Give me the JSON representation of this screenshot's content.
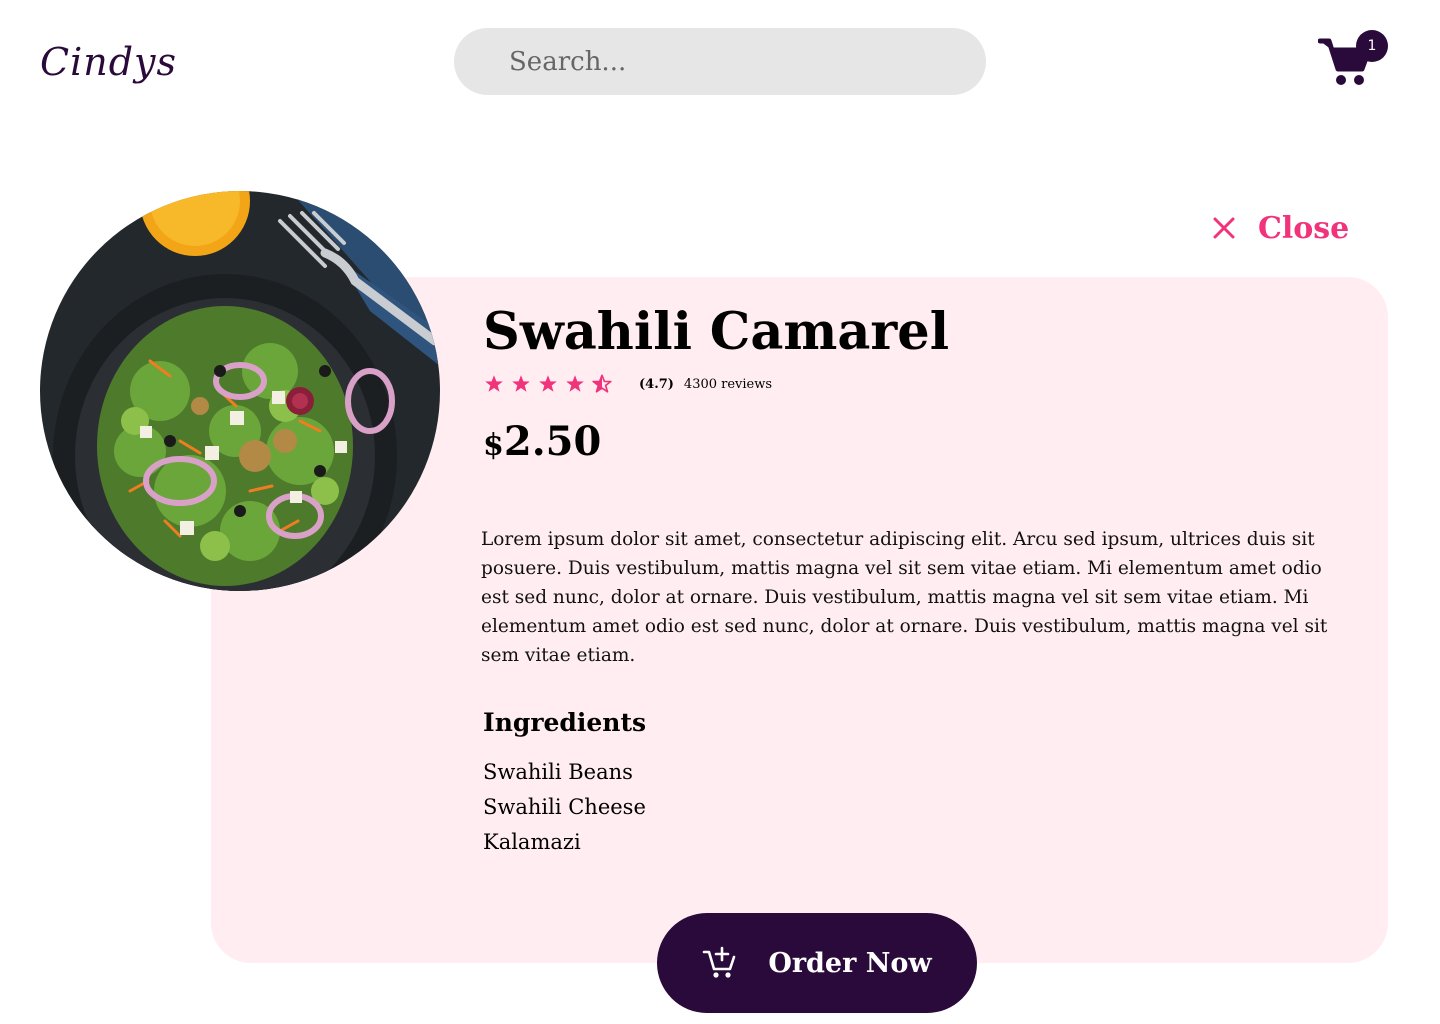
{
  "header": {
    "logo": "Cindys",
    "search_placeholder": "Search...",
    "cart_count": "1",
    "cart_icon": "cart-icon"
  },
  "dialog": {
    "close_label": "Close",
    "close_icon": "close-icon"
  },
  "product": {
    "name": "Swahili Camarel",
    "rating": 4.7,
    "rating_label": "(4.7)",
    "reviews": "4300 reviews",
    "price_symbol": "$",
    "price_value": "2.50",
    "description": "Lorem ipsum dolor sit amet, consectetur adipiscing elit. Arcu sed ipsum, ultrices duis sit posuere. Duis vestibulum, mattis magna vel sit sem vitae etiam. Mi elementum amet odio est sed nunc, dolor at ornare.  Duis vestibulum, mattis magna vel sit sem vitae etiam. Mi elementum amet odio est sed nunc, dolor at ornare. Duis vestibulum, mattis magna vel sit sem vitae etiam.",
    "ingredients_heading": "Ingredients",
    "ingredients": [
      "Swahili Beans",
      "Swahili Cheese",
      "Kalamazi"
    ]
  },
  "order": {
    "label": "Order Now",
    "icon": "add-to-cart-icon"
  },
  "colors": {
    "brand": "#2a0a3a",
    "accent": "#f0337a",
    "card_background": "#ffedf1",
    "search_background": "#e6e6e6"
  }
}
